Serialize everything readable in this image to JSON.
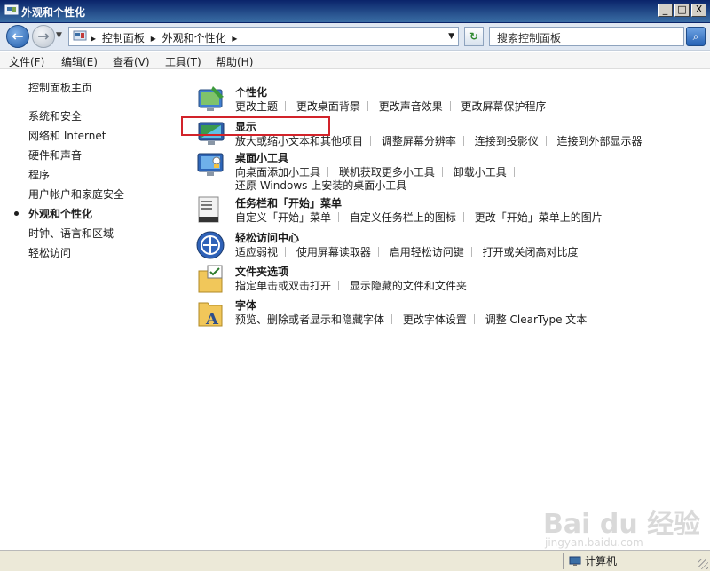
{
  "window": {
    "title": "外观和个性化",
    "minimize": "_",
    "maximize": "□",
    "close": "X"
  },
  "address": {
    "crumbs": [
      "▸",
      "控制面板",
      "▸",
      "外观和个性化",
      "▸"
    ],
    "search_placeholder": "搜索控制面板"
  },
  "menu": [
    "文件(F)",
    "编辑(E)",
    "查看(V)",
    "工具(T)",
    "帮助(H)"
  ],
  "left_nav": {
    "home": "控制面板主页",
    "items": [
      "系统和安全",
      "网络和 Internet",
      "硬件和声音",
      "程序",
      "用户帐户和家庭安全",
      "外观和个性化",
      "时钟、语言和区域",
      "轻松访问"
    ],
    "active_index": 5
  },
  "categories": [
    {
      "title": "个性化",
      "links": [
        "更改主题",
        "更改桌面背景",
        "更改声音效果",
        "更改屏幕保护程序"
      ],
      "links2": []
    },
    {
      "title": "显示",
      "links": [
        "放大或缩小文本和其他项目",
        "调整屏幕分辨率",
        "连接到投影仪",
        "连接到外部显示器"
      ],
      "links2": []
    },
    {
      "title": "桌面小工具",
      "links": [
        "向桌面添加小工具",
        "联机获取更多小工具",
        "卸载小工具"
      ],
      "links2": [
        "还原 Windows 上安装的桌面小工具"
      ]
    },
    {
      "title": "任务栏和「开始」菜单",
      "links": [
        "自定义「开始」菜单",
        "自定义任务栏上的图标",
        "更改「开始」菜单上的图片"
      ],
      "links2": []
    },
    {
      "title": "轻松访问中心",
      "links": [
        "适应弱视",
        "使用屏幕读取器",
        "启用轻松访问键",
        "打开或关闭高对比度"
      ],
      "links2": []
    },
    {
      "title": "文件夹选项",
      "links": [
        "指定单击或双击打开",
        "显示隐藏的文件和文件夹"
      ],
      "links2": []
    },
    {
      "title": "字体",
      "links": [
        "预览、删除或者显示和隐藏字体",
        "更改字体设置",
        "调整 ClearType 文本"
      ],
      "links2": []
    }
  ],
  "status": {
    "location": "计算机"
  },
  "watermark": {
    "logo": "Bai du 经验",
    "url": "jingyan.baidu.com"
  },
  "colors": {
    "highlight": "#d2232a",
    "title_bar": "#0a246a"
  }
}
